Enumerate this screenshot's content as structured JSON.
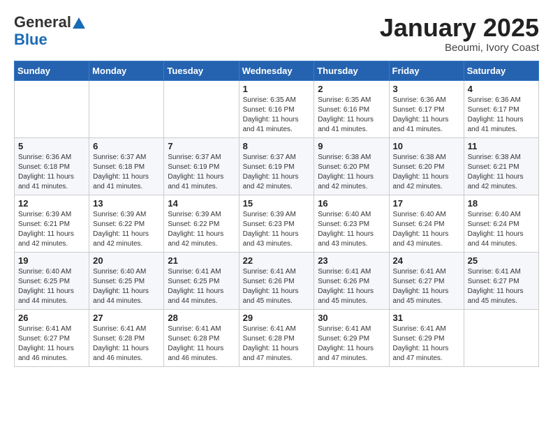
{
  "header": {
    "logo_general": "General",
    "logo_blue": "Blue",
    "title": "January 2025",
    "subtitle": "Beoumi, Ivory Coast"
  },
  "weekdays": [
    "Sunday",
    "Monday",
    "Tuesday",
    "Wednesday",
    "Thursday",
    "Friday",
    "Saturday"
  ],
  "weeks": [
    [
      {
        "day": "",
        "info": ""
      },
      {
        "day": "",
        "info": ""
      },
      {
        "day": "",
        "info": ""
      },
      {
        "day": "1",
        "info": "Sunrise: 6:35 AM\nSunset: 6:16 PM\nDaylight: 11 hours and 41 minutes."
      },
      {
        "day": "2",
        "info": "Sunrise: 6:35 AM\nSunset: 6:16 PM\nDaylight: 11 hours and 41 minutes."
      },
      {
        "day": "3",
        "info": "Sunrise: 6:36 AM\nSunset: 6:17 PM\nDaylight: 11 hours and 41 minutes."
      },
      {
        "day": "4",
        "info": "Sunrise: 6:36 AM\nSunset: 6:17 PM\nDaylight: 11 hours and 41 minutes."
      }
    ],
    [
      {
        "day": "5",
        "info": "Sunrise: 6:36 AM\nSunset: 6:18 PM\nDaylight: 11 hours and 41 minutes."
      },
      {
        "day": "6",
        "info": "Sunrise: 6:37 AM\nSunset: 6:18 PM\nDaylight: 11 hours and 41 minutes."
      },
      {
        "day": "7",
        "info": "Sunrise: 6:37 AM\nSunset: 6:19 PM\nDaylight: 11 hours and 41 minutes."
      },
      {
        "day": "8",
        "info": "Sunrise: 6:37 AM\nSunset: 6:19 PM\nDaylight: 11 hours and 42 minutes."
      },
      {
        "day": "9",
        "info": "Sunrise: 6:38 AM\nSunset: 6:20 PM\nDaylight: 11 hours and 42 minutes."
      },
      {
        "day": "10",
        "info": "Sunrise: 6:38 AM\nSunset: 6:20 PM\nDaylight: 11 hours and 42 minutes."
      },
      {
        "day": "11",
        "info": "Sunrise: 6:38 AM\nSunset: 6:21 PM\nDaylight: 11 hours and 42 minutes."
      }
    ],
    [
      {
        "day": "12",
        "info": "Sunrise: 6:39 AM\nSunset: 6:21 PM\nDaylight: 11 hours and 42 minutes."
      },
      {
        "day": "13",
        "info": "Sunrise: 6:39 AM\nSunset: 6:22 PM\nDaylight: 11 hours and 42 minutes."
      },
      {
        "day": "14",
        "info": "Sunrise: 6:39 AM\nSunset: 6:22 PM\nDaylight: 11 hours and 42 minutes."
      },
      {
        "day": "15",
        "info": "Sunrise: 6:39 AM\nSunset: 6:23 PM\nDaylight: 11 hours and 43 minutes."
      },
      {
        "day": "16",
        "info": "Sunrise: 6:40 AM\nSunset: 6:23 PM\nDaylight: 11 hours and 43 minutes."
      },
      {
        "day": "17",
        "info": "Sunrise: 6:40 AM\nSunset: 6:24 PM\nDaylight: 11 hours and 43 minutes."
      },
      {
        "day": "18",
        "info": "Sunrise: 6:40 AM\nSunset: 6:24 PM\nDaylight: 11 hours and 44 minutes."
      }
    ],
    [
      {
        "day": "19",
        "info": "Sunrise: 6:40 AM\nSunset: 6:25 PM\nDaylight: 11 hours and 44 minutes."
      },
      {
        "day": "20",
        "info": "Sunrise: 6:40 AM\nSunset: 6:25 PM\nDaylight: 11 hours and 44 minutes."
      },
      {
        "day": "21",
        "info": "Sunrise: 6:41 AM\nSunset: 6:25 PM\nDaylight: 11 hours and 44 minutes."
      },
      {
        "day": "22",
        "info": "Sunrise: 6:41 AM\nSunset: 6:26 PM\nDaylight: 11 hours and 45 minutes."
      },
      {
        "day": "23",
        "info": "Sunrise: 6:41 AM\nSunset: 6:26 PM\nDaylight: 11 hours and 45 minutes."
      },
      {
        "day": "24",
        "info": "Sunrise: 6:41 AM\nSunset: 6:27 PM\nDaylight: 11 hours and 45 minutes."
      },
      {
        "day": "25",
        "info": "Sunrise: 6:41 AM\nSunset: 6:27 PM\nDaylight: 11 hours and 45 minutes."
      }
    ],
    [
      {
        "day": "26",
        "info": "Sunrise: 6:41 AM\nSunset: 6:27 PM\nDaylight: 11 hours and 46 minutes."
      },
      {
        "day": "27",
        "info": "Sunrise: 6:41 AM\nSunset: 6:28 PM\nDaylight: 11 hours and 46 minutes."
      },
      {
        "day": "28",
        "info": "Sunrise: 6:41 AM\nSunset: 6:28 PM\nDaylight: 11 hours and 46 minutes."
      },
      {
        "day": "29",
        "info": "Sunrise: 6:41 AM\nSunset: 6:28 PM\nDaylight: 11 hours and 47 minutes."
      },
      {
        "day": "30",
        "info": "Sunrise: 6:41 AM\nSunset: 6:29 PM\nDaylight: 11 hours and 47 minutes."
      },
      {
        "day": "31",
        "info": "Sunrise: 6:41 AM\nSunset: 6:29 PM\nDaylight: 11 hours and 47 minutes."
      },
      {
        "day": "",
        "info": ""
      }
    ]
  ]
}
